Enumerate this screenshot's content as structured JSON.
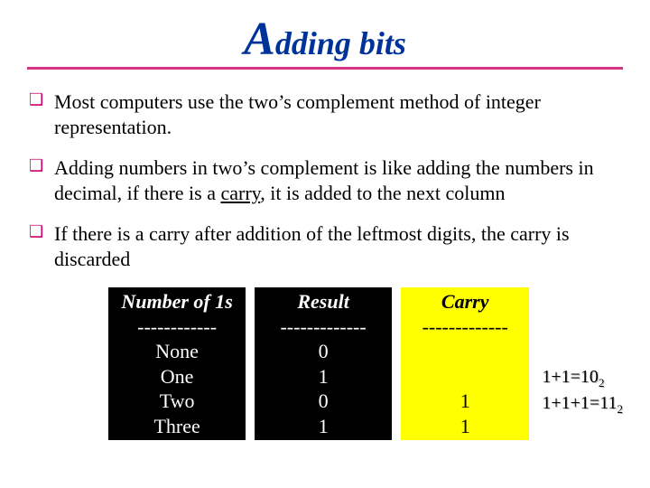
{
  "title_big": "A",
  "title_rest": "dding bits",
  "bullets": [
    "Most computers use the two’s complement method of integer representation.",
    "Adding numbers in two’s complement is like adding the numbers in decimal, if there is a carry, it is added to the next column",
    "If there is a carry after addition of the leftmost digits, the carry is discarded"
  ],
  "carry_word": "carry",
  "table": {
    "col1": {
      "header": "Number of 1s",
      "sep": "------------",
      "rows": [
        "None",
        "One",
        "Two",
        "Three"
      ]
    },
    "col2": {
      "header": "Result",
      "sep": "-------------",
      "rows": [
        "0",
        "1",
        "0",
        "1"
      ]
    },
    "col3": {
      "header": "Carry",
      "sep": "-------------",
      "rows": [
        " ",
        " ",
        "1",
        "1"
      ]
    }
  },
  "annotations": {
    "line1_pre": "1+1=10",
    "line1_sub": "2",
    "line2_pre": "1+1+1=11",
    "line2_sub": "2"
  },
  "chart_data": {
    "type": "table",
    "title": "Adding bits — carry table",
    "columns": [
      "Number of 1s",
      "Result",
      "Carry"
    ],
    "rows": [
      [
        "None",
        0,
        null
      ],
      [
        "One",
        1,
        null
      ],
      [
        "Two",
        0,
        1
      ],
      [
        "Three",
        1,
        1
      ]
    ],
    "annotations": [
      "1+1=10 (base 2)",
      "1+1+1=11 (base 2)"
    ]
  }
}
